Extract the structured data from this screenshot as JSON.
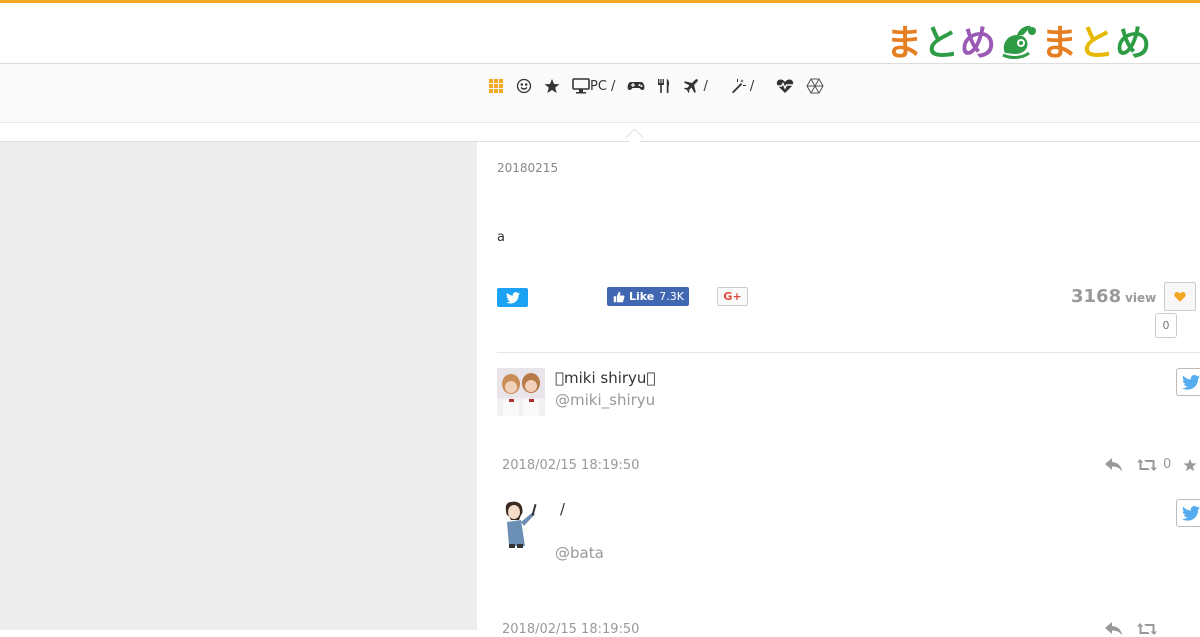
{
  "header": {
    "logo": [
      "ま",
      "と",
      "め",
      "ま",
      "と",
      "め"
    ],
    "logo_colors": [
      "#e67e22",
      "#2e9b45",
      "#9b59b6",
      "#e67e22",
      "#e6b800",
      "#2e9b45"
    ],
    "accent_color": "#f5a623"
  },
  "nav": {
    "items": [
      {
        "icon": "grid-icon",
        "label": ""
      },
      {
        "icon": "smile-icon",
        "label": ""
      },
      {
        "icon": "star-icon",
        "label": ""
      },
      {
        "icon": "desktop-icon",
        "label": "PC /"
      },
      {
        "icon": "gamepad-icon",
        "label": ""
      },
      {
        "icon": "cutlery-icon",
        "label": ""
      },
      {
        "icon": "plane-icon",
        "label": "/"
      },
      {
        "icon": "magic-wand-icon",
        "label": "/"
      },
      {
        "icon": "heartbeat-icon",
        "label": ""
      },
      {
        "icon": "hexagon-icon",
        "label": ""
      }
    ]
  },
  "article": {
    "date": "20180215",
    "body": "a",
    "share": {
      "facebook_label": "Like",
      "facebook_count": "7.3K",
      "gplus_label": "G+"
    },
    "views": "3168",
    "views_unit": "view",
    "favorite_count": "0"
  },
  "tweets": [
    {
      "name": "\u0000miki shiryu\u0000",
      "handle": "@miki_shiryu",
      "time": "2018/02/15 18:19:50",
      "retweets": "0"
    },
    {
      "text": "/",
      "handle": "@bata",
      "time": "2018/02/15 18:19:50"
    }
  ]
}
